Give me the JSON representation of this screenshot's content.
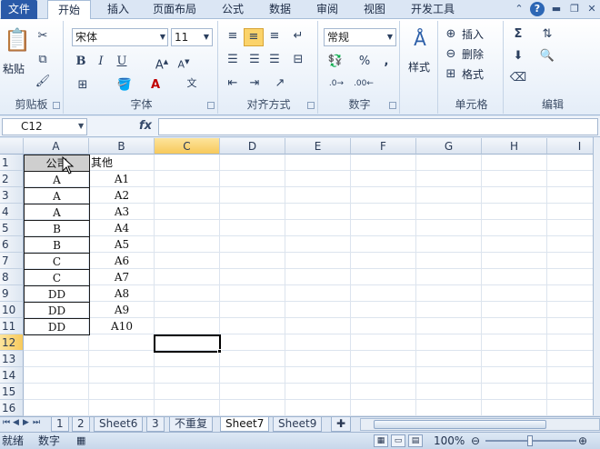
{
  "ribbon_tabs": [
    {
      "label": "文件"
    },
    {
      "label": "开始"
    },
    {
      "label": "插入"
    },
    {
      "label": "页面布局"
    },
    {
      "label": "公式"
    },
    {
      "label": "数据"
    },
    {
      "label": "审阅"
    },
    {
      "label": "视图"
    },
    {
      "label": "开发工具"
    }
  ],
  "ribbon": {
    "clipboard": {
      "paste": "粘贴",
      "label": "剪贴板"
    },
    "font": {
      "name": "宋体",
      "size": "11",
      "bold": "B",
      "italic": "I",
      "underline": "U",
      "label": "字体"
    },
    "alignment": {
      "label": "对齐方式"
    },
    "number": {
      "format": "常规",
      "percent": "%",
      "comma": ",",
      "label": "数字"
    },
    "styles": {
      "label": "样式"
    },
    "cells": {
      "insert": "插入",
      "delete": "删除",
      "format": "格式",
      "label": "单元格"
    },
    "editing": {
      "label": "编辑"
    }
  },
  "formula_bar": {
    "name_box": "C12",
    "fx": "fx",
    "content": ""
  },
  "columns": [
    "A",
    "B",
    "C",
    "D",
    "E",
    "F",
    "G",
    "H",
    "I"
  ],
  "rows": [
    "1",
    "2",
    "3",
    "4",
    "5",
    "6",
    "7",
    "8",
    "9",
    "10",
    "11",
    "12",
    "13",
    "14",
    "15",
    "16"
  ],
  "cells": {
    "A": [
      "公司",
      "A",
      "A",
      "A",
      "B",
      "B",
      "C",
      "C",
      "DD",
      "DD",
      "DD"
    ],
    "B": [
      "其他",
      "A1",
      "A2",
      "A3",
      "A4",
      "A5",
      "A6",
      "A7",
      "A8",
      "A9",
      "A10"
    ]
  },
  "sheet_tabs": [
    {
      "label": "1"
    },
    {
      "label": "2"
    },
    {
      "label": "Sheet6"
    },
    {
      "label": "3"
    },
    {
      "label": "不重复"
    },
    {
      "label": "Sheet7"
    },
    {
      "label": "Sheet9"
    }
  ],
  "active_sheet": "Sheet7",
  "status": {
    "ready": "就绪",
    "mode": "数字",
    "zoom": "100%"
  },
  "colors": {
    "selected_header": "#f7c95b",
    "file_tab": "#2a5aa8"
  }
}
